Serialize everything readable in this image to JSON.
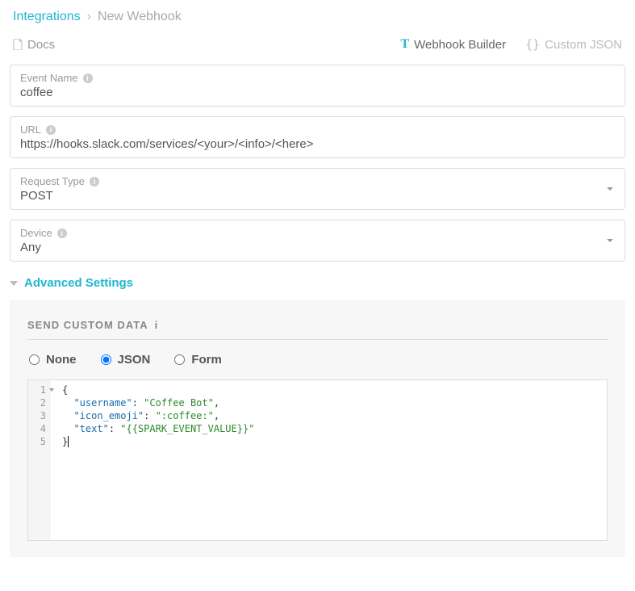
{
  "breadcrumb": {
    "root": "Integrations",
    "current": "New Webhook"
  },
  "header": {
    "docs": "Docs",
    "tab_builder": "Webhook Builder",
    "tab_custom": "Custom JSON"
  },
  "fields": {
    "event_name": {
      "label": "Event Name",
      "value": "coffee"
    },
    "url": {
      "label": "URL",
      "value": "https://hooks.slack.com/services/<your>/<info>/<here>"
    },
    "request_type": {
      "label": "Request Type",
      "value": "POST"
    },
    "device": {
      "label": "Device",
      "value": "Any"
    }
  },
  "advanced": {
    "toggle": "Advanced Settings",
    "section_title": "SEND CUSTOM DATA",
    "radio_none": "None",
    "radio_json": "JSON",
    "radio_form": "Form",
    "selected": "JSON"
  },
  "editor": {
    "lines": [
      "1",
      "2",
      "3",
      "4",
      "5"
    ],
    "json_body": {
      "username": "Coffee Bot",
      "icon_emoji": ":coffee:",
      "text": "{{SPARK_EVENT_VALUE}}"
    }
  }
}
